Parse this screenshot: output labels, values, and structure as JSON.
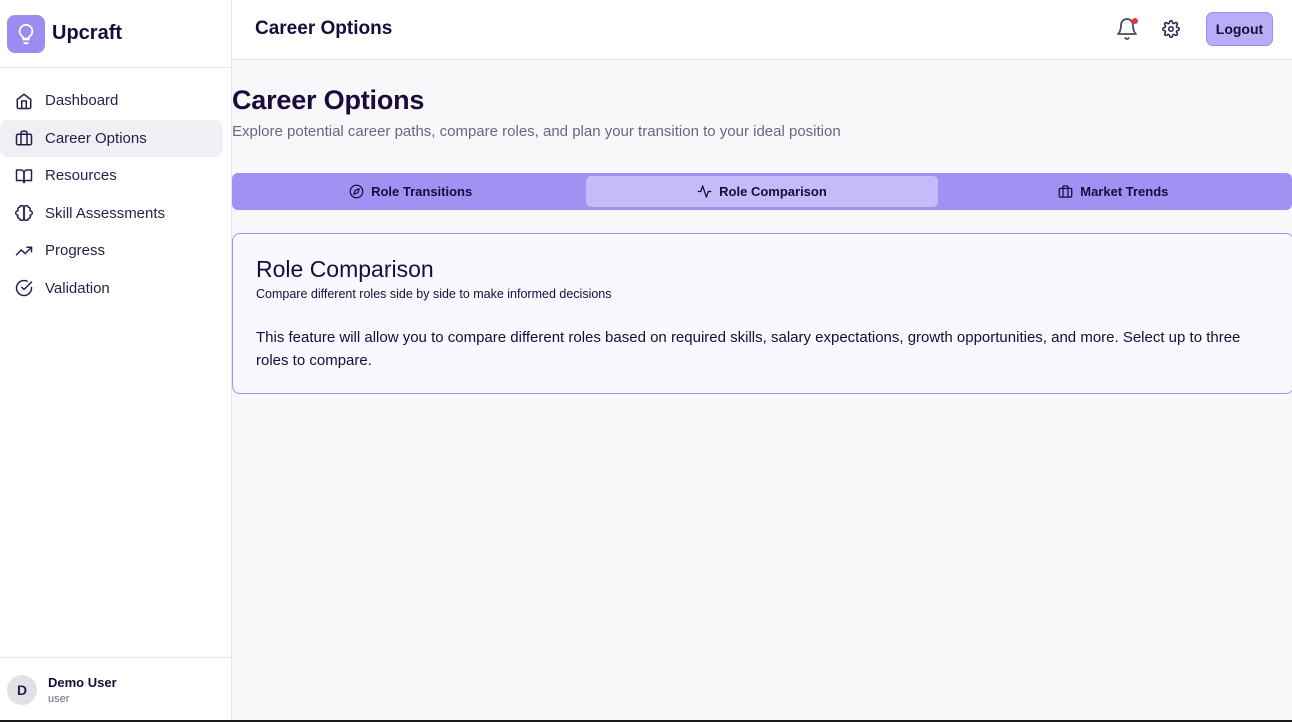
{
  "app": {
    "name": "Upcraft"
  },
  "sidebar": {
    "items": [
      {
        "label": "Dashboard",
        "icon": "home-icon",
        "active": false
      },
      {
        "label": "Career Options",
        "icon": "briefcase-icon",
        "active": true
      },
      {
        "label": "Resources",
        "icon": "book-icon",
        "active": false
      },
      {
        "label": "Skill Assessments",
        "icon": "brain-icon",
        "active": false
      },
      {
        "label": "Progress",
        "icon": "trending-up-icon",
        "active": false
      },
      {
        "label": "Validation",
        "icon": "check-circle-icon",
        "active": false
      }
    ],
    "user": {
      "initial": "D",
      "name": "Demo User",
      "role": "user"
    }
  },
  "topbar": {
    "title": "Career Options",
    "logout_label": "Logout",
    "has_notification": true
  },
  "page": {
    "title": "Career Options",
    "subtitle": "Explore potential career paths, compare roles, and plan your transition to your ideal position"
  },
  "tabs": [
    {
      "label": "Role Transitions",
      "icon": "compass-icon",
      "active": false
    },
    {
      "label": "Role Comparison",
      "icon": "activity-icon",
      "active": true
    },
    {
      "label": "Market Trends",
      "icon": "briefcase-icon",
      "active": false
    }
  ],
  "card": {
    "title": "Role Comparison",
    "subtitle": "Compare different roles side by side to make informed decisions",
    "body": "This feature will allow you to compare different roles based on required skills, salary expectations, growth opportunities, and more. Select up to three roles to compare."
  },
  "colors": {
    "accent": "#9f92f3",
    "accent_light": "#c4bbf8",
    "text_dark": "#1a0b3b",
    "notification": "#e53935"
  }
}
